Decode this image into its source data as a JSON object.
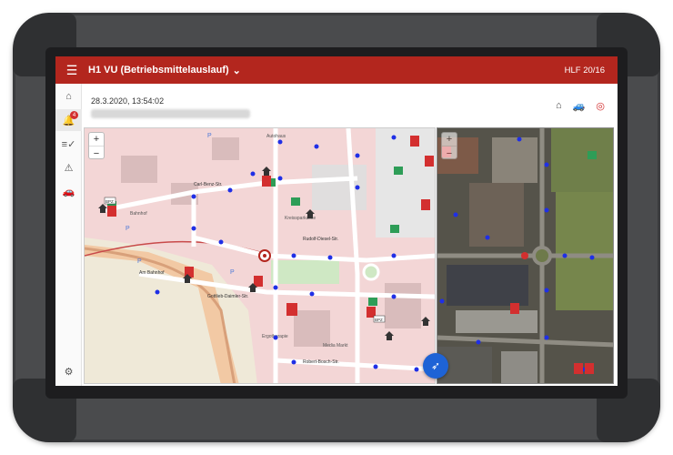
{
  "appbar": {
    "menu_icon": "menu-icon",
    "title": "H1 VU (Betriebsmittelauslauf)",
    "dropdown_icon": "chevron-down-icon",
    "vehicle": "HLF 20/16"
  },
  "sidebar": {
    "items": [
      {
        "name": "home",
        "icon": "home-icon"
      },
      {
        "name": "notifications",
        "icon": "bell-icon",
        "badge": "4"
      },
      {
        "name": "checklist",
        "icon": "checklist-icon"
      },
      {
        "name": "hazards",
        "icon": "warning-icon"
      },
      {
        "name": "vehicles",
        "icon": "car-icon"
      }
    ],
    "settings_icon": "gear-icon"
  },
  "header": {
    "timestamp": "28.3.2020, 13:54:02",
    "icons": [
      "home-icon",
      "car-icon",
      "target-icon"
    ]
  },
  "map": {
    "zoom_in": "+",
    "zoom_out": "−",
    "labels": {
      "street_1": "Rudolf-Diesel-Str.",
      "street_2": "Gottlieb-Daimler-Str.",
      "street_3": "Robert-Bosch-Str.",
      "street_4": "Carl-Benz-Str.",
      "street_5": "Am Bahnhof",
      "poi_1": "Ergotherapie",
      "poi_2": "Kreissparkasse",
      "poi_3": "Autohaus",
      "poi_4": "Media Markt",
      "bus_stop": "Bahnhof",
      "parking": "P",
      "sign_1": "BPZ",
      "sign_2": "BPZ"
    }
  },
  "satellite": {
    "zoom_in": "+",
    "zoom_out": "−"
  },
  "fab": {
    "icon": "navigation-icon"
  },
  "colors": {
    "appbar": "#b3261e",
    "marker_blue": "#1f2fe6",
    "marker_red": "#d32f2f",
    "marker_green": "#2e9d57",
    "fab": "#1e63d6"
  }
}
